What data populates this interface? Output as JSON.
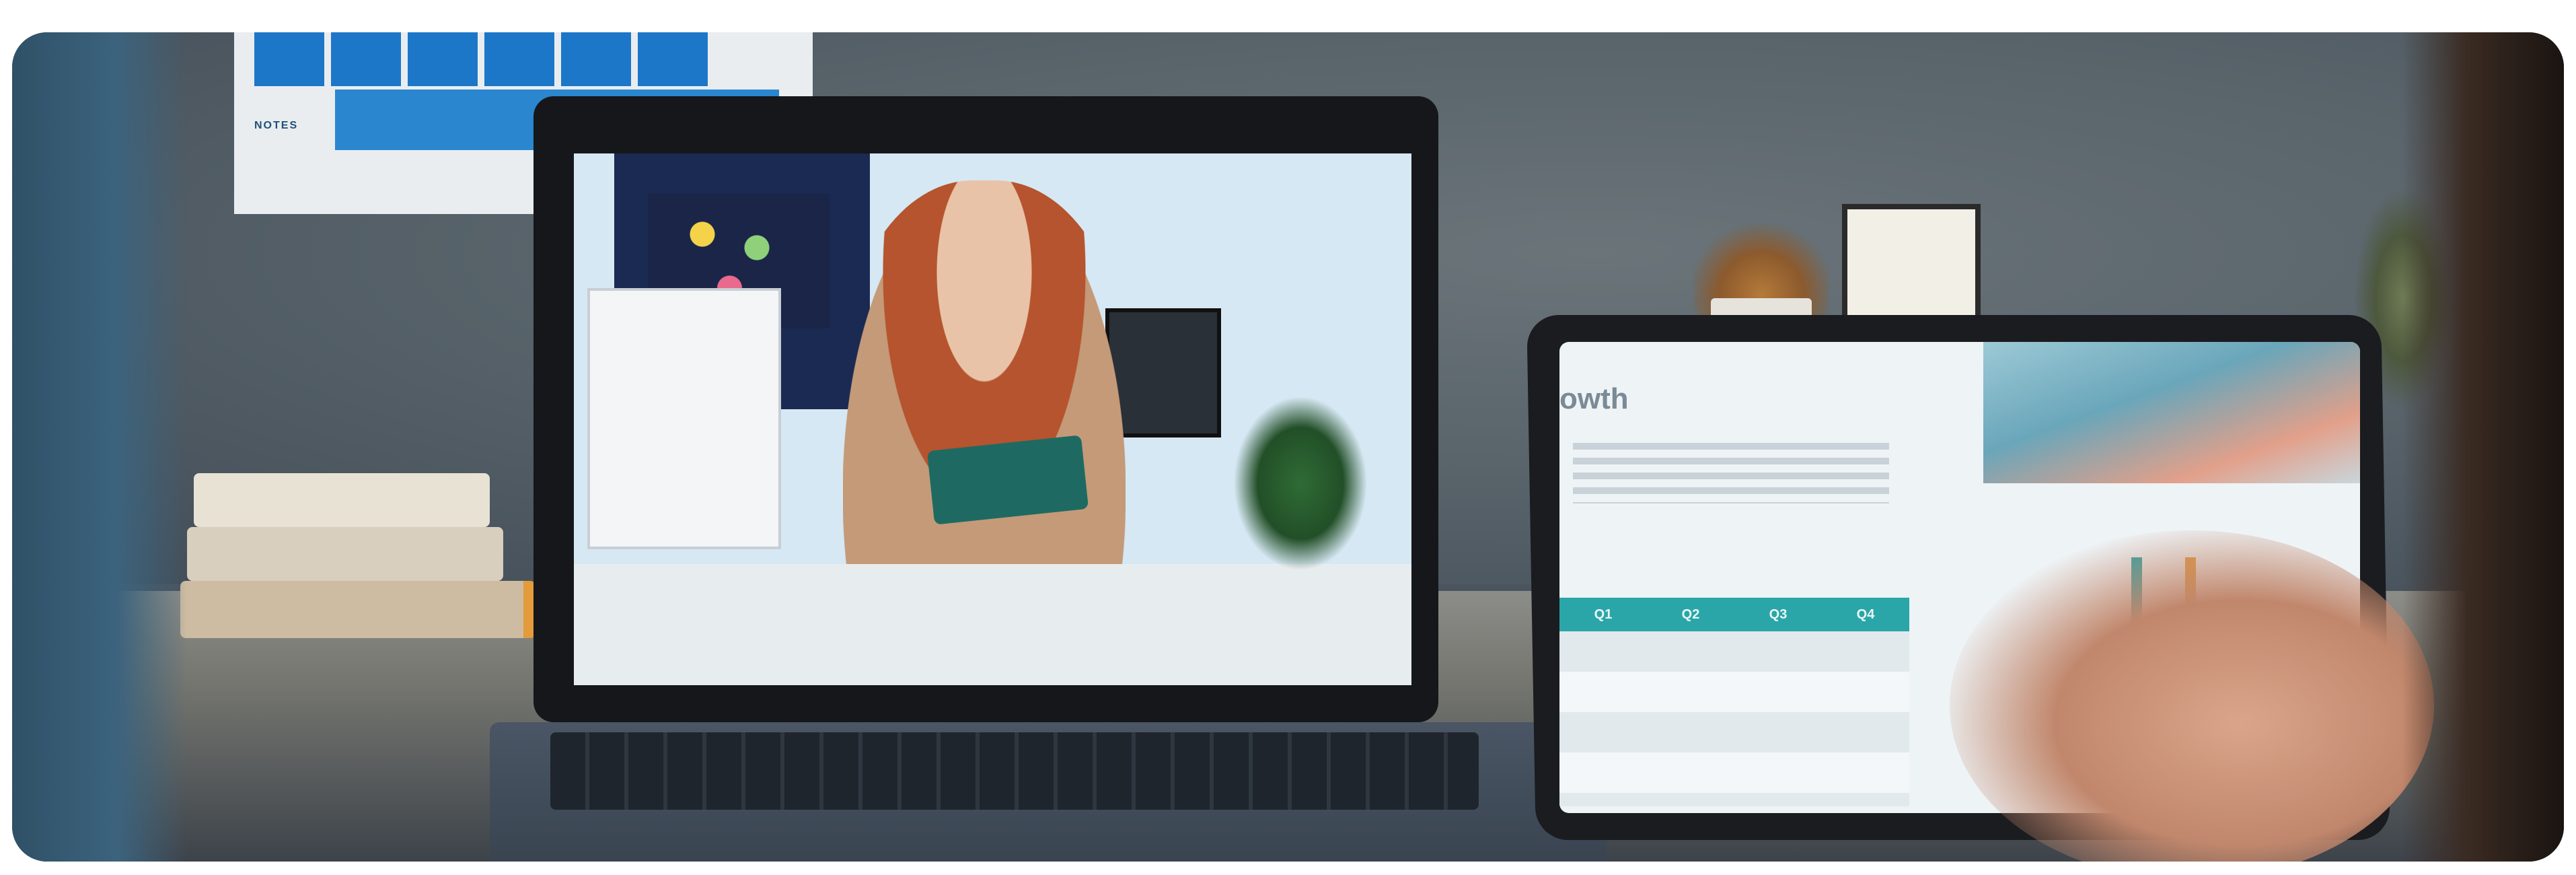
{
  "image": {
    "alt": "Woman presenting on a laptop video call while a hand gestures at a tablet showing growth charts"
  },
  "wall_planner": {
    "notes_label": "NOTES"
  },
  "tablet": {
    "heading_fragment": "owth",
    "table_headers": [
      "Q1",
      "Q2",
      "Q3",
      "Q4"
    ]
  },
  "colors": {
    "planner_blue": "#1d77c8",
    "teal_accent": "#2aa6a8",
    "wall": "#59646b"
  }
}
